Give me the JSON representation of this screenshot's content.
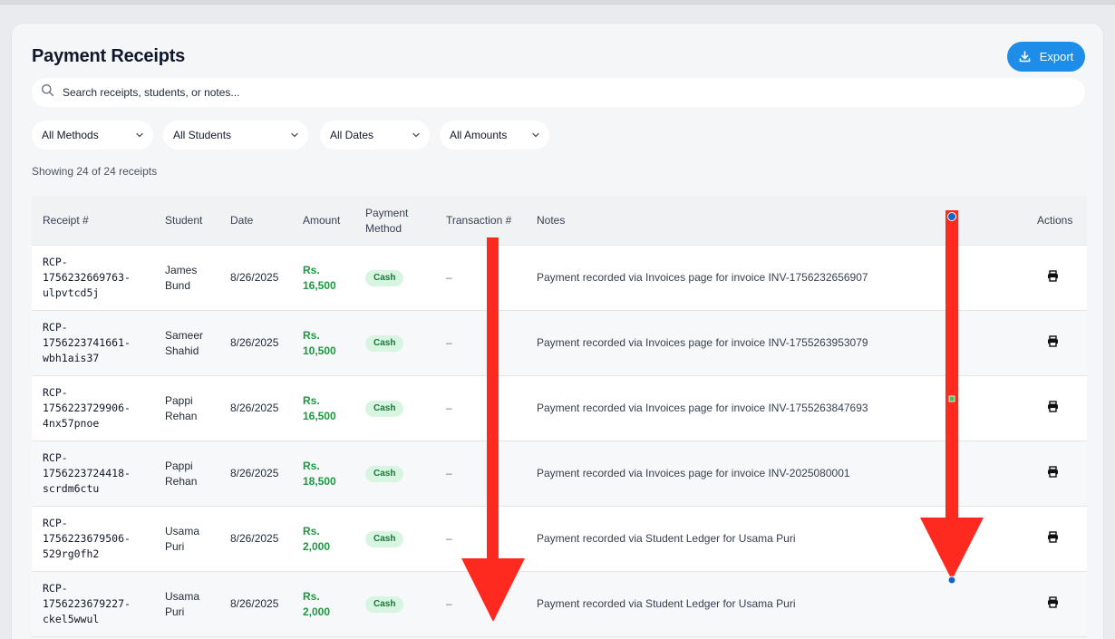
{
  "page": {
    "title": "Payment Receipts",
    "export_label": "Export",
    "search_placeholder": "Search receipts, students, or notes...",
    "showing_text": "Showing 24 of 24 receipts"
  },
  "filters": [
    {
      "label": "All Methods"
    },
    {
      "label": "All Students"
    },
    {
      "label": "All Dates"
    },
    {
      "label": "All Amounts"
    }
  ],
  "table": {
    "headers": {
      "receipt": "Receipt #",
      "student": "Student",
      "date": "Date",
      "amount": "Amount",
      "method_line1": "Payment",
      "method_line2": "Method",
      "transaction": "Transaction #",
      "notes": "Notes",
      "actions": "Actions"
    },
    "rows": [
      {
        "receipt": [
          "RCP-",
          "1756232669763-",
          "ulpvtcd5j"
        ],
        "student": [
          "James",
          "Bund"
        ],
        "date": "8/26/2025",
        "amount": [
          "Rs.",
          "16,500"
        ],
        "method": "Cash",
        "transaction": "–",
        "notes": "Payment recorded via Invoices page for invoice INV-1756232656907"
      },
      {
        "receipt": [
          "RCP-",
          "1756223741661-",
          "wbh1ais37"
        ],
        "student": [
          "Sameer",
          "Shahid"
        ],
        "date": "8/26/2025",
        "amount": [
          "Rs.",
          "10,500"
        ],
        "method": "Cash",
        "transaction": "–",
        "notes": "Payment recorded via Invoices page for invoice INV-1755263953079"
      },
      {
        "receipt": [
          "RCP-",
          "1756223729906-",
          "4nx57pnoe"
        ],
        "student": [
          "Pappi",
          "Rehan"
        ],
        "date": "8/26/2025",
        "amount": [
          "Rs.",
          "16,500"
        ],
        "method": "Cash",
        "transaction": "–",
        "notes": "Payment recorded via Invoices page for invoice INV-1755263847693"
      },
      {
        "receipt": [
          "RCP-",
          "1756223724418-",
          "scrdm6ctu"
        ],
        "student": [
          "Pappi",
          "Rehan"
        ],
        "date": "8/26/2025",
        "amount": [
          "Rs.",
          "18,500"
        ],
        "method": "Cash",
        "transaction": "–",
        "notes": "Payment recorded via Invoices page for invoice INV-2025080001"
      },
      {
        "receipt": [
          "RCP-",
          "1756223679506-",
          "529rg0fh2"
        ],
        "student": [
          "Usama",
          "Puri"
        ],
        "date": "8/26/2025",
        "amount": [
          "Rs.",
          "2,000"
        ],
        "method": "Cash",
        "transaction": "–",
        "notes": "Payment recorded via Student Ledger for Usama Puri"
      },
      {
        "receipt": [
          "RCP-",
          "1756223679227-",
          "ckel5wwul"
        ],
        "student": [
          "Usama",
          "Puri"
        ],
        "date": "8/26/2025",
        "amount": [
          "Rs.",
          "2,000"
        ],
        "method": "Cash",
        "transaction": "–",
        "notes": "Payment recorded via Student Ledger for Usama Puri"
      }
    ]
  },
  "colors": {
    "accent": "#1e8de8",
    "amount_green": "#1b9a3f",
    "badge_bg": "#d8f5e1",
    "annotation_red": "#ff2a1f",
    "handle_blue": "#1565c0"
  },
  "icons": {
    "search": "search-icon",
    "export": "download-icon",
    "chevron": "chevron-down-icon",
    "print": "printer-icon"
  }
}
